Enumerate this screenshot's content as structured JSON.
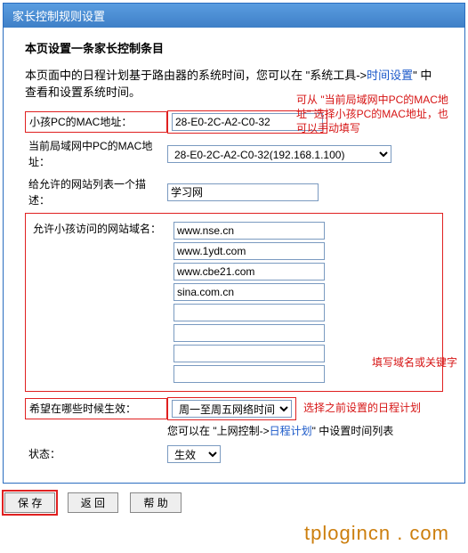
{
  "title_bar": "家长控制规则设置",
  "intro_bold": "本页设置一条家长控制条目",
  "intro_text1": "本页面中的日程计划基于路由器的系统时间，您可以在 \"系统工具->",
  "intro_time_link": "时间设置",
  "intro_text2": "\" 中查看和设置系统时间。",
  "annot_mac": "可从 \"当前局域网中PC的MAC地址\" 选择小孩PC的MAC地址，也可以手动填写",
  "annot_domain": "填写域名或关键字",
  "annot_sched": "选择之前设置的日程计划",
  "rows": {
    "child_mac_label": "小孩PC的MAC地址：",
    "child_mac_value": "28-E0-2C-A2-C0-32",
    "lan_mac_label": "当前局域网中PC的MAC地址：",
    "lan_mac_value": "28-E0-2C-A2-C0-32(192.168.1.100)",
    "desc_label": "给允许的网站列表一个描述：",
    "desc_value": "学习网",
    "domain_label": "允许小孩访问的网站域名：",
    "domain_values": [
      "www.nse.cn",
      "www.1ydt.com",
      "www.cbe21.com",
      "sina.com.cn",
      "",
      "",
      "",
      ""
    ],
    "sched_label": "希望在哪些时候生效：",
    "sched_value": "周一至周五网络时间",
    "sched_tip1": "您可以在 \"上网控制->",
    "sched_tip_link": "日程计划",
    "sched_tip2": "\" 中设置时间列表",
    "status_label": "状态：",
    "status_value": "生效"
  },
  "buttons": {
    "save": "保 存",
    "back": "返 回",
    "help": "帮 助"
  },
  "watermark": "tplogincn . com"
}
